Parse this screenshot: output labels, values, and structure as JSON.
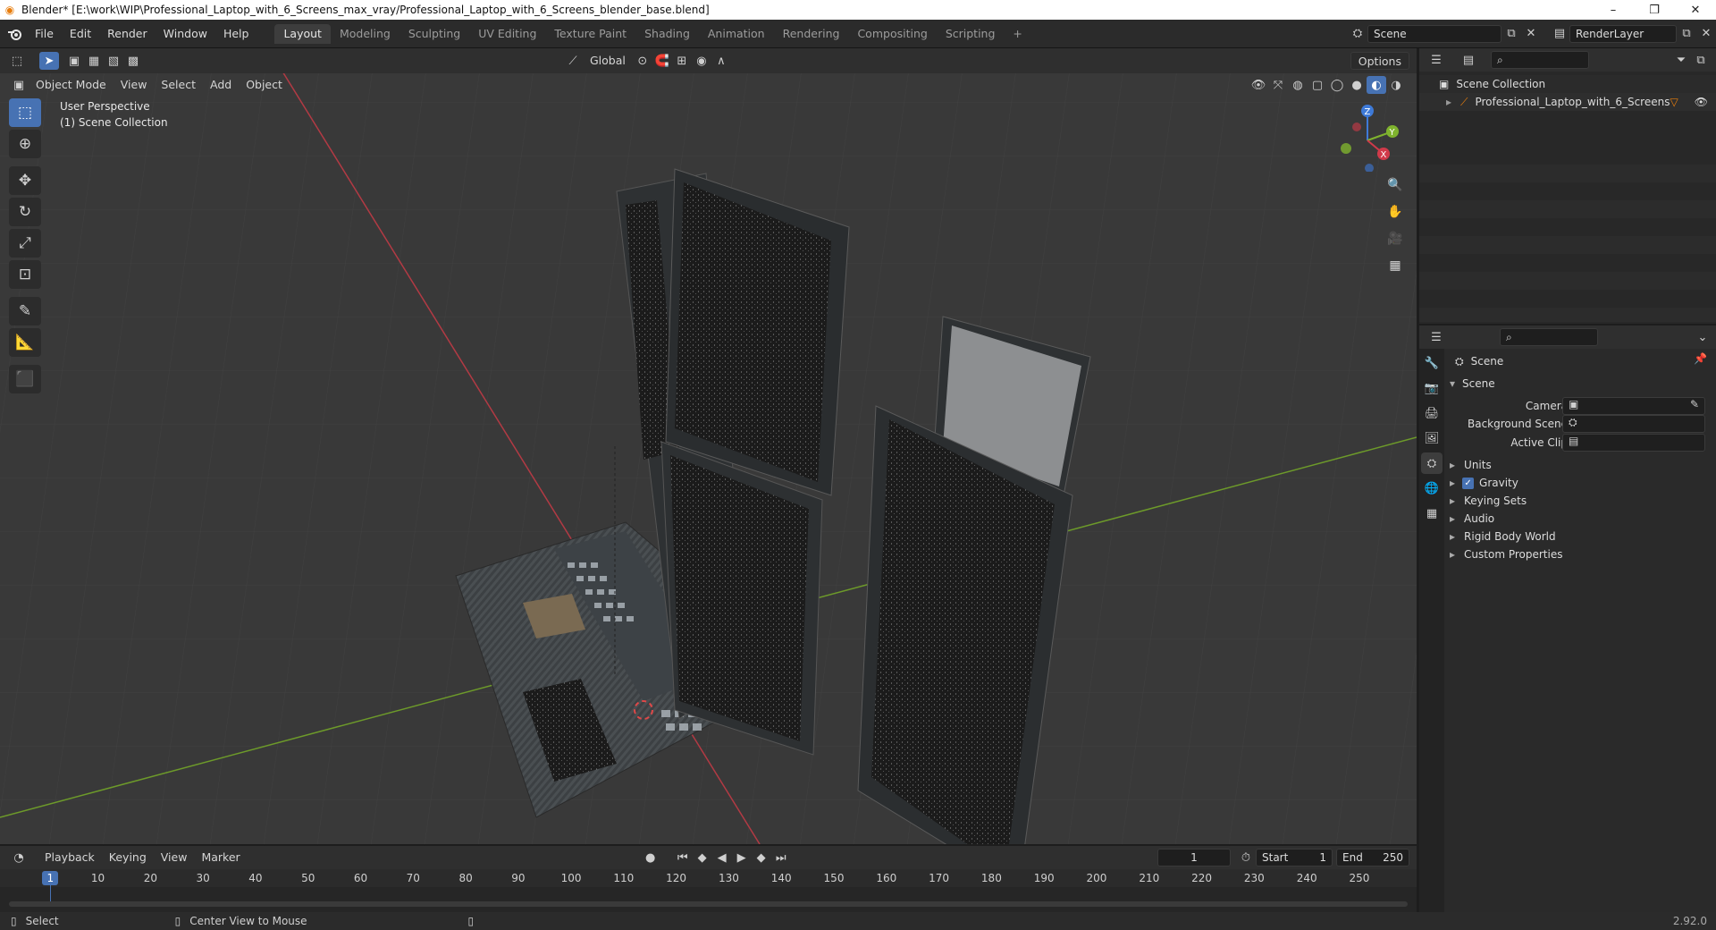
{
  "titlebar": {
    "title": "Blender* [E:\\work\\WIP\\Professional_Laptop_with_6_Screens_max_vray/Professional_Laptop_with_6_Screens_blender_base.blend]",
    "minimize": "–",
    "maximize": "❐",
    "close": "✕"
  },
  "menu": [
    "File",
    "Edit",
    "Render",
    "Window",
    "Help"
  ],
  "workspaces": [
    "Layout",
    "Modeling",
    "Sculpting",
    "UV Editing",
    "Texture Paint",
    "Shading",
    "Animation",
    "Rendering",
    "Compositing",
    "Scripting"
  ],
  "workspace_add": "+",
  "scene_field": "Scene",
  "renderlayer_field": "RenderLayer",
  "viewport": {
    "mode": "Object Mode",
    "menus": [
      "View",
      "Select",
      "Add",
      "Object"
    ],
    "transform_orientation": "Global",
    "options": "Options",
    "info_line1": "User Perspective",
    "info_line2": "(1) Scene Collection",
    "gizmo": {
      "x": "X",
      "y": "Y",
      "z": "Z"
    }
  },
  "outliner": {
    "root": "Scene Collection",
    "items": [
      {
        "label": "Professional_Laptop_with_6_Screens"
      }
    ]
  },
  "properties": {
    "context": "Scene",
    "panel_title": "Scene",
    "fields": [
      {
        "label": "Camera"
      },
      {
        "label": "Background Scene"
      },
      {
        "label": "Active Clip"
      }
    ],
    "sections": [
      "Units",
      "Gravity",
      "Keying Sets",
      "Audio",
      "Rigid Body World",
      "Custom Properties"
    ],
    "gravity_checked": true
  },
  "timeline": {
    "menus": [
      "Playback",
      "Keying",
      "View",
      "Marker"
    ],
    "current_frame": "1",
    "start_label": "Start",
    "start_value": "1",
    "end_label": "End",
    "end_value": "250",
    "ruler": [
      "1",
      "10",
      "20",
      "30",
      "40",
      "50",
      "60",
      "70",
      "80",
      "90",
      "100",
      "110",
      "120",
      "130",
      "140",
      "150",
      "160",
      "170",
      "180",
      "190",
      "200",
      "210",
      "220",
      "230",
      "240",
      "250"
    ]
  },
  "statusbar": {
    "left_action": "Select",
    "mid_action": "Center View to Mouse",
    "version": "2.92.0"
  },
  "colors": {
    "accent": "#4772b3",
    "x_axis": "#d13a4a",
    "y_axis": "#7fb32e",
    "z_axis": "#3e7ad8",
    "object_orange": "#e87d0d"
  }
}
